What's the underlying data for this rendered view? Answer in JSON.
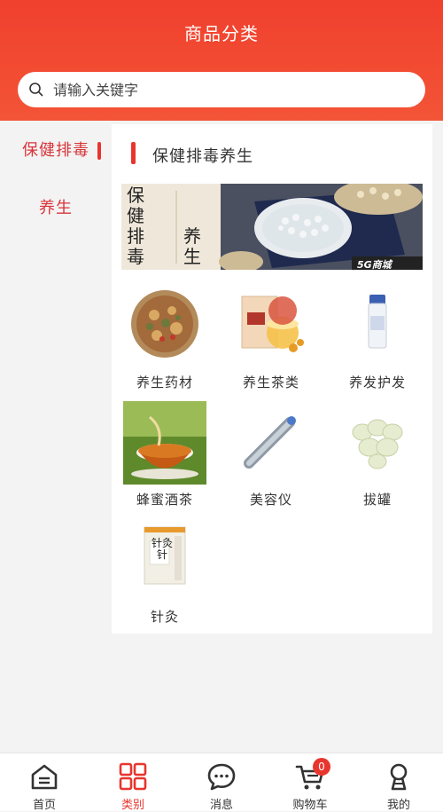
{
  "header": {
    "title": "商品分类"
  },
  "search": {
    "placeholder": "请输入关键字",
    "value": ""
  },
  "sidebar": {
    "items": [
      {
        "label": "保健排毒",
        "active": true
      },
      {
        "label": "养生",
        "active": false
      }
    ]
  },
  "category": {
    "title": "保健排毒养生",
    "banner": {
      "text_left_col1": "保",
      "text_left_col2": "健",
      "text_left_col3": "排",
      "text_left_col4": "毒",
      "text_right_1": "养",
      "text_right_2": "生",
      "logo": "5G商城"
    },
    "items": [
      {
        "label": "养生药材",
        "icon": "herbs-image"
      },
      {
        "label": "养生茶类",
        "icon": "tea-package-image"
      },
      {
        "label": "养发护发",
        "icon": "hair-care-bottle-image"
      },
      {
        "label": "蜂蜜酒茶",
        "icon": "tea-cup-image"
      },
      {
        "label": "美容仪",
        "icon": "beauty-device-image"
      },
      {
        "label": "拔罐",
        "icon": "cupping-glass-image"
      },
      {
        "label": "针灸",
        "icon": "acupuncture-box-image"
      }
    ]
  },
  "tabbar": {
    "items": [
      {
        "label": "首页",
        "icon": "home-icon",
        "active": false
      },
      {
        "label": "类别",
        "icon": "category-icon",
        "active": true
      },
      {
        "label": "消息",
        "icon": "message-icon",
        "active": false
      },
      {
        "label": "购物车",
        "icon": "cart-icon",
        "active": false,
        "badge": "0"
      },
      {
        "label": "我的",
        "icon": "profile-icon",
        "active": false
      }
    ]
  },
  "colors": {
    "brand": "#f0402e",
    "accent": "#e8352e",
    "active_text": "#d8353a"
  }
}
